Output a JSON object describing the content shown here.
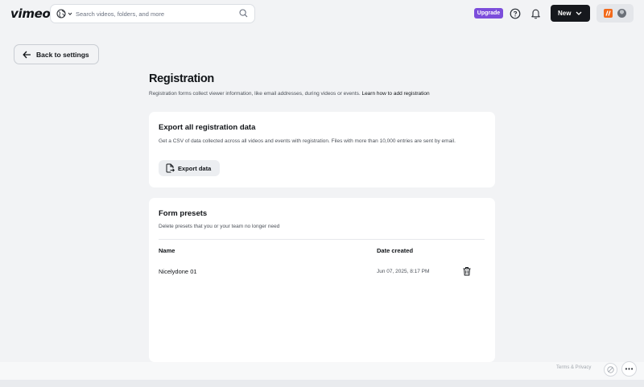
{
  "header": {
    "logo_text": "vimeo",
    "search_placeholder": "Search videos, folders, and more",
    "upgrade_label": "Upgrade",
    "new_label": "New",
    "icons": [
      "globe-icon",
      "chevron-down-icon",
      "search-icon",
      "help-icon",
      "bell-icon",
      "team-logo",
      "avatar"
    ]
  },
  "nav": {
    "back_label": "Back to settings"
  },
  "page": {
    "title": "Registration",
    "description": "Registration forms collect viewer information, like email addresses, during videos or events.",
    "learn_link": "Learn how to add registration"
  },
  "export_card": {
    "title": "Export all registration data",
    "description": "Get a CSV of data collected across all videos and events with registration. Files with more than 10,000 entries are sent by email.",
    "button_label": "Export data"
  },
  "presets_card": {
    "title": "Form presets",
    "description": "Delete presets that you or your team no longer need",
    "columns": [
      "Name",
      "Date created"
    ],
    "rows": [
      {
        "name": "Nicelydone 01",
        "date_created": "Jun 07, 2025, 8:17 PM"
      }
    ]
  },
  "footer": {
    "terms_label": "Terms & Privacy"
  },
  "colors": {
    "background": "#f2f3f5",
    "upgrade": "#7c4ddb",
    "new_button": "#16181d",
    "team_logo": "#f26a1b"
  }
}
